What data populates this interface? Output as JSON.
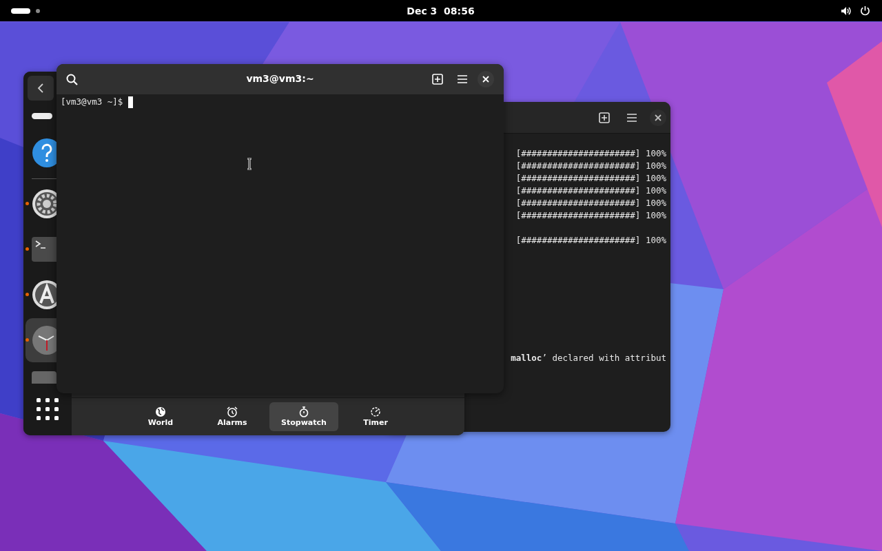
{
  "top_bar": {
    "clock": "Dec 3  08:56"
  },
  "clocks_window": {
    "dock_items": [
      {
        "kind": "pill",
        "running": false,
        "selected": false
      },
      {
        "kind": "help",
        "running": false,
        "selected": false
      },
      {
        "kind": "divider",
        "running": false,
        "selected": false
      },
      {
        "kind": "settings",
        "running": true,
        "selected": false
      },
      {
        "kind": "terminal",
        "running": true,
        "selected": false
      },
      {
        "kind": "software",
        "running": true,
        "selected": false
      },
      {
        "kind": "clock",
        "running": true,
        "selected": true
      },
      {
        "kind": "partial",
        "running": false,
        "selected": false
      }
    ],
    "tabs": [
      {
        "label": "World",
        "kind": "world",
        "selected": false
      },
      {
        "label": "Alarms",
        "kind": "alarms",
        "selected": false
      },
      {
        "label": "Stopwatch",
        "kind": "stopwatch",
        "selected": true
      },
      {
        "label": "Timer",
        "kind": "timer",
        "selected": false
      }
    ]
  },
  "back_terminal": {
    "blocks": [
      [
        "[######################] 100%",
        "[######################] 100%",
        "[######################] 100%",
        "[######################] 100%",
        "[######################] 100%",
        "[######################] 100%"
      ],
      [
        "[######################] 100%"
      ]
    ],
    "warning": "**malloc**’ declared with attribut"
  },
  "front_terminal": {
    "title": "vm3@vm3:~",
    "prompt": "[vm3@vm3 ~]$"
  }
}
